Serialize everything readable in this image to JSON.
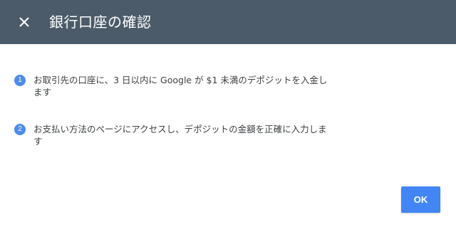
{
  "dialog": {
    "title": "銀行口座の確認"
  },
  "steps": [
    {
      "number": "1",
      "text": "お取引先の口座に、3 日以内に Google が $1 未満のデポジットを入金します"
    },
    {
      "number": "2",
      "text": "お支払い方法のページにアクセスし、デポジットの金額を正確に入力します"
    }
  ],
  "actions": {
    "ok_label": "OK"
  },
  "icons": {
    "close": "close-icon"
  },
  "colors": {
    "header_bg": "#4b5b69",
    "accent": "#4285f4",
    "step_badge": "#4a8cf1"
  }
}
